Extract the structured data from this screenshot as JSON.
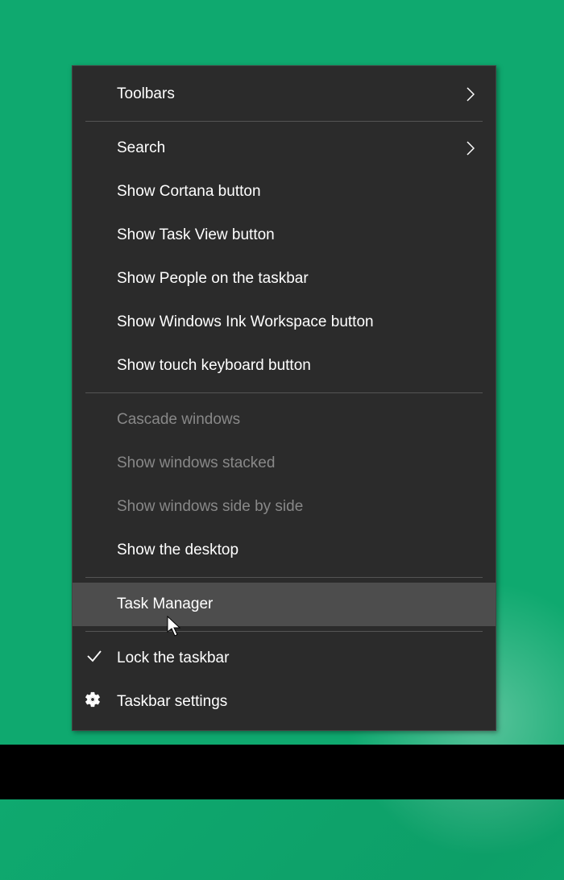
{
  "menu": {
    "items": [
      {
        "label": "Toolbars",
        "hasSubmenu": true,
        "enabled": true
      },
      {
        "separator": true
      },
      {
        "label": "Search",
        "hasSubmenu": true,
        "enabled": true
      },
      {
        "label": "Show Cortana button",
        "enabled": true
      },
      {
        "label": "Show Task View button",
        "enabled": true
      },
      {
        "label": "Show People on the taskbar",
        "enabled": true
      },
      {
        "label": "Show Windows Ink Workspace button",
        "enabled": true
      },
      {
        "label": "Show touch keyboard button",
        "enabled": true
      },
      {
        "separator": true
      },
      {
        "label": "Cascade windows",
        "enabled": false
      },
      {
        "label": "Show windows stacked",
        "enabled": false
      },
      {
        "label": "Show windows side by side",
        "enabled": false
      },
      {
        "label": "Show the desktop",
        "enabled": true
      },
      {
        "separator": true
      },
      {
        "label": "Task Manager",
        "enabled": true,
        "highlighted": true
      },
      {
        "separator": true
      },
      {
        "label": "Lock the taskbar",
        "enabled": true,
        "checked": true
      },
      {
        "label": "Taskbar settings",
        "enabled": true,
        "icon": "gear"
      }
    ]
  }
}
